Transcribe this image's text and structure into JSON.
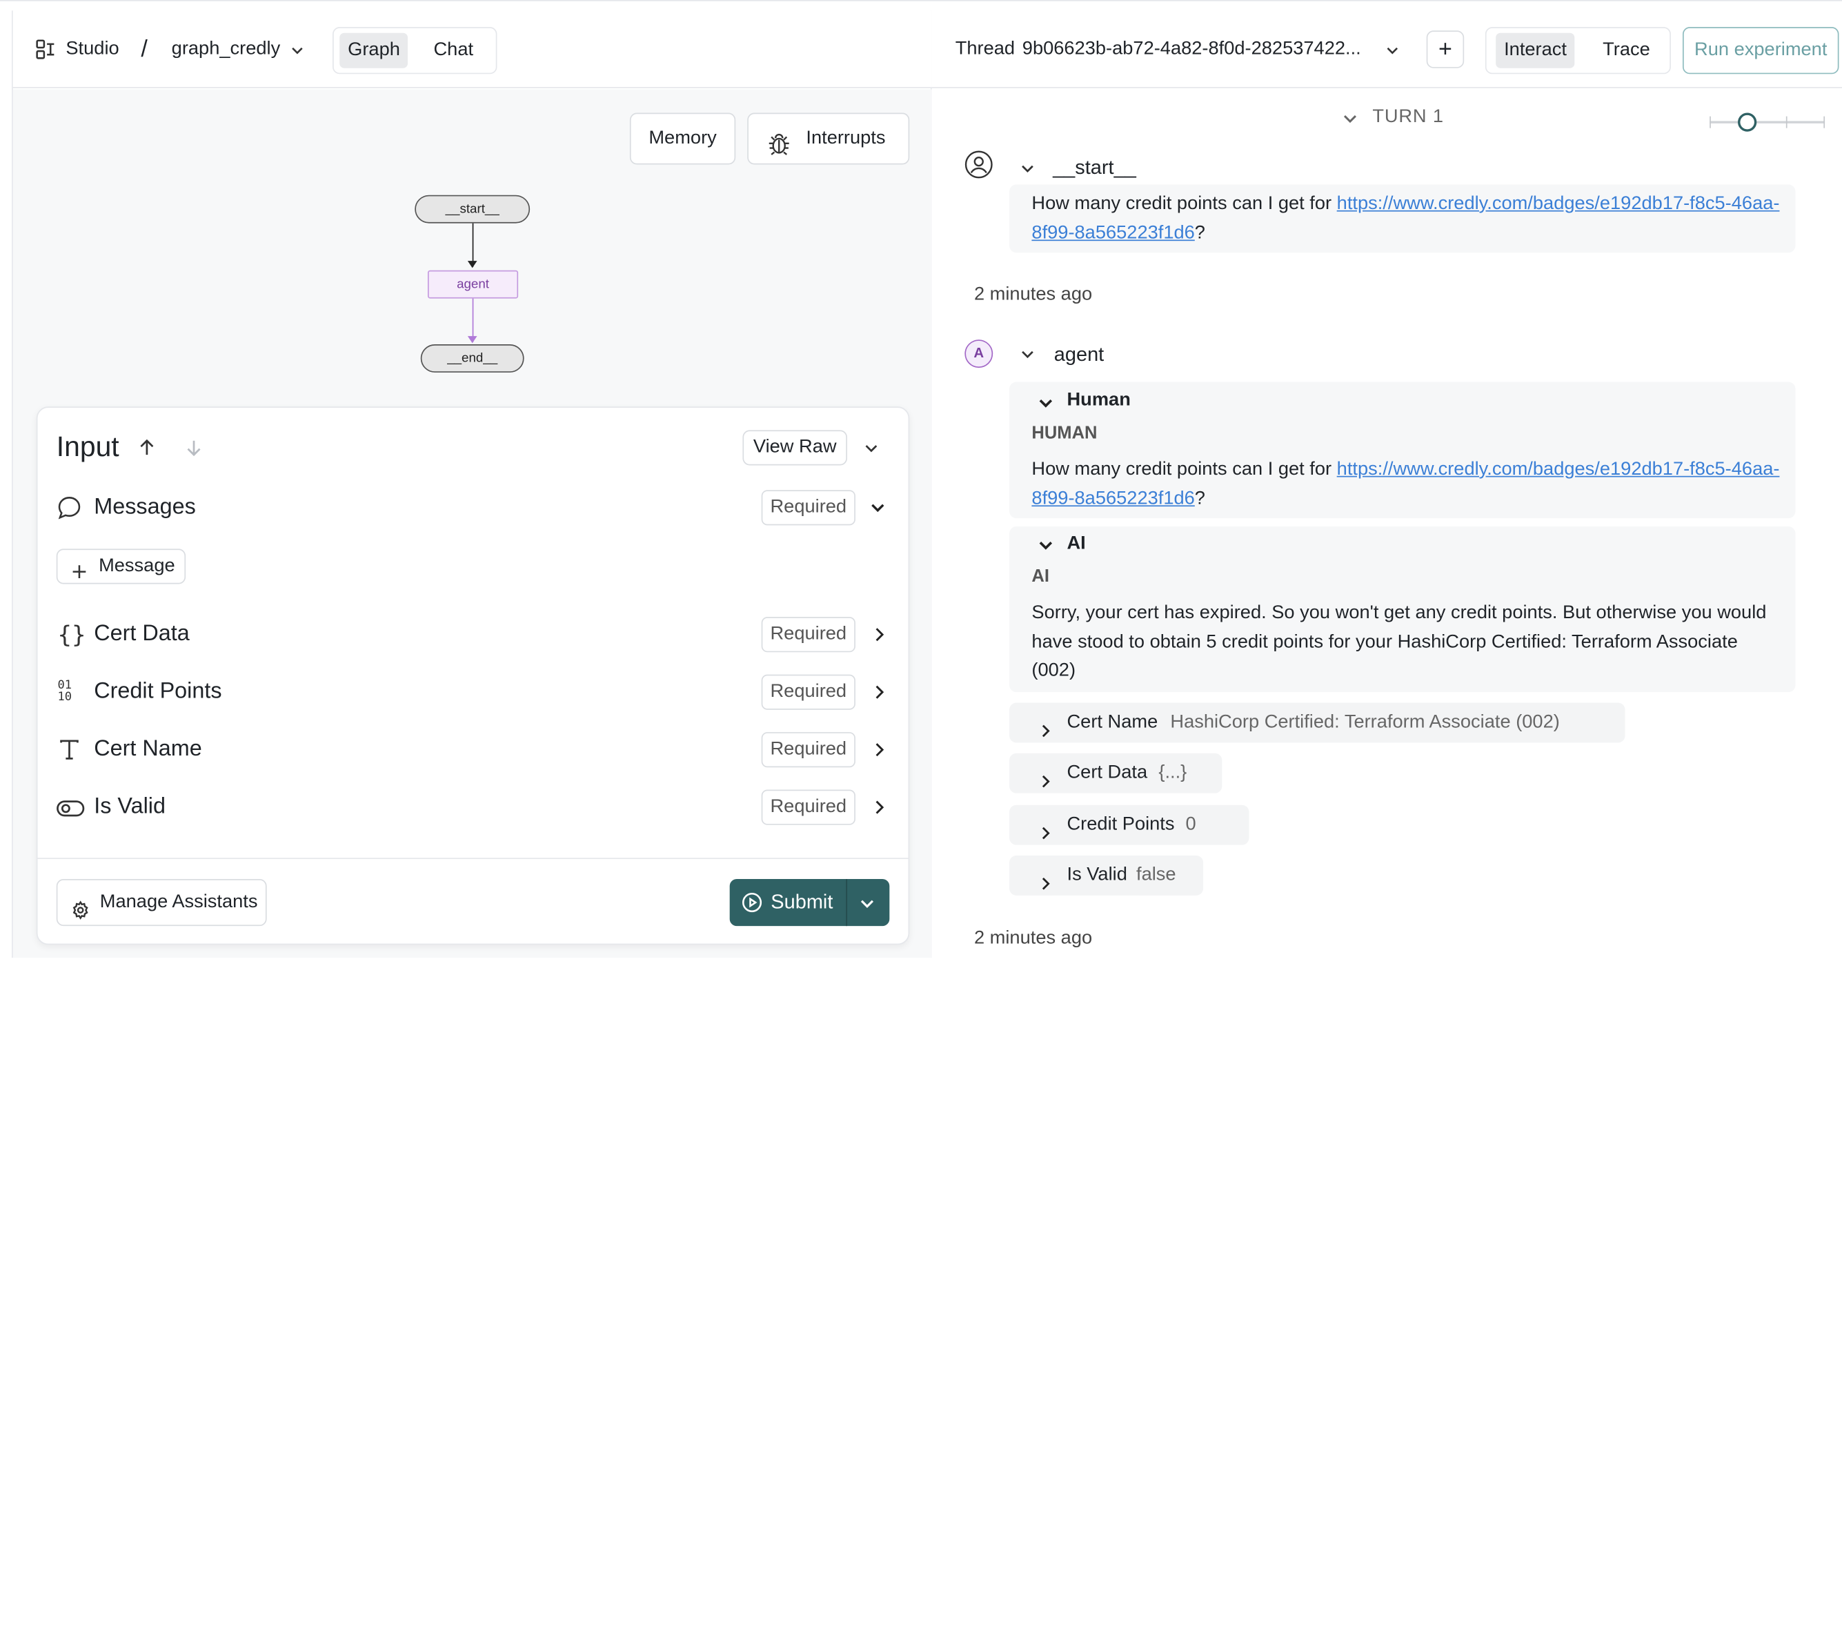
{
  "topbar_left": {
    "studio_label": "Studio",
    "separator": "/",
    "graph_name": "graph_credly",
    "tabs": [
      "Graph",
      "Chat"
    ]
  },
  "topbar_right": {
    "thread_label": "Thread",
    "thread_id": "9b06623b-ab72-4a82-8f0d-282537422...",
    "add_label": "+",
    "mode_tabs": [
      "Interact",
      "Trace"
    ],
    "run_experiment_label": "Run experiment"
  },
  "graph": {
    "memory_label": "Memory",
    "interrupts_label": "Interrupts",
    "nodes": [
      "__start__",
      "agent",
      "__end__"
    ]
  },
  "input_panel": {
    "title": "Input",
    "view_raw_label": "View Raw",
    "messages_label": "Messages",
    "add_message_label": "Message",
    "fields": [
      {
        "label": "Cert Data",
        "status": "Required"
      },
      {
        "label": "Credit Points",
        "status": "Required"
      },
      {
        "label": "Cert Name",
        "status": "Required"
      },
      {
        "label": "Is Valid",
        "status": "Required"
      }
    ],
    "messages_status": "Required",
    "manage_assistants_label": "Manage Assistants",
    "submit_label": "Submit"
  },
  "thread": {
    "turn_label": "TURN 1",
    "start_node": "__start__",
    "start_message_prefix": "How many credit points can I get for ",
    "start_message_link": "https://www.credly.com/badges/e192db17-f8c5-46aa-8f99-8a565223f1d6",
    "start_message_suffix": "?",
    "time_1": "2 minutes ago",
    "agent_avatar": "A",
    "agent_node": "agent",
    "human_header": "Human",
    "human_role": "HUMAN",
    "human_message_prefix": "How many credit points can I get for ",
    "human_message_link": "https://www.credly.com/badges/e192db17-f8c5-46aa-8f99-8a565223f1d6",
    "human_message_suffix": "?",
    "ai_header": "AI",
    "ai_role": "AI",
    "ai_message": "Sorry, your cert has expired. So you won't get any credit points. But otherwise you would have stood to obtain 5 credit points for your HashiCorp Certified: Terraform Associate (002)",
    "state_fields": [
      {
        "key": "Cert Name",
        "value": "HashiCorp Certified: Terraform Associate (002)"
      },
      {
        "key": "Cert Data",
        "value": "{...}"
      },
      {
        "key": "Credit Points",
        "value": "0"
      },
      {
        "key": "Is Valid",
        "value": "false"
      }
    ],
    "time_2": "2 minutes ago"
  },
  "colors": {
    "accent": "#2f6164",
    "link": "#3b7fd6",
    "agent_node_border": "#c59be0",
    "agent_node_text": "#7a3fa0"
  }
}
